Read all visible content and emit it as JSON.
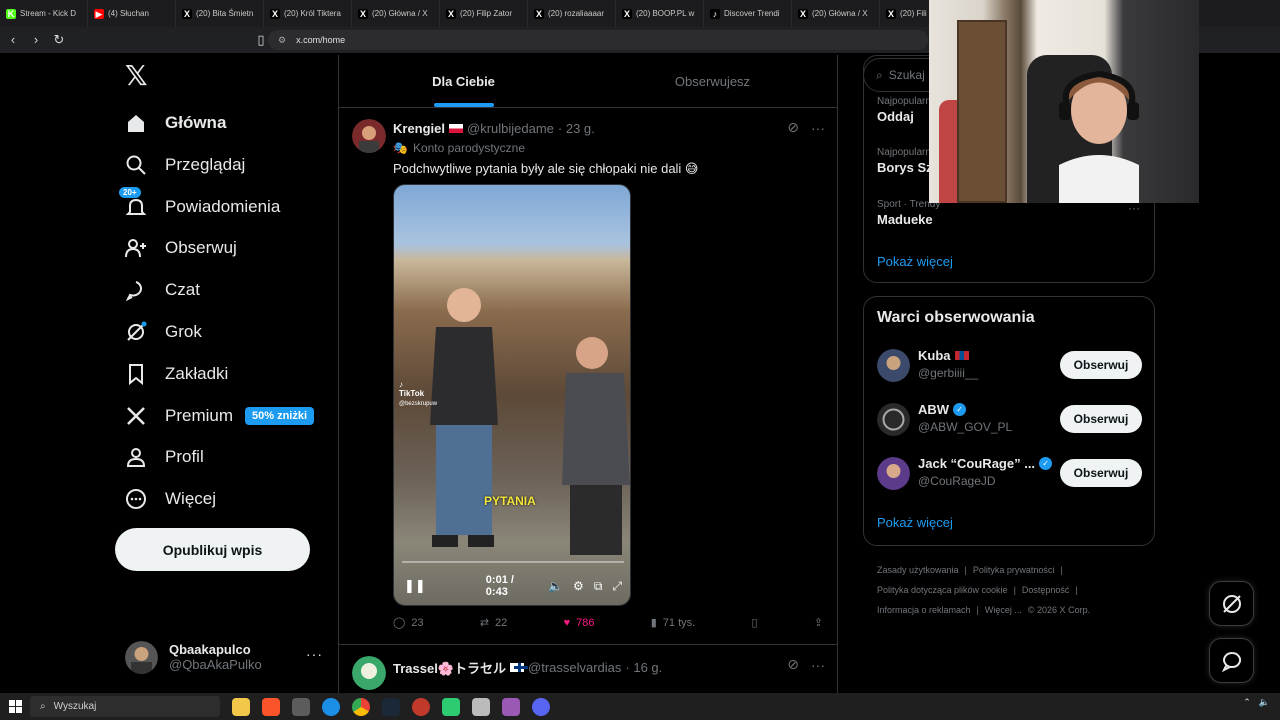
{
  "browser": {
    "tabs": [
      {
        "label": "Stream - Kick D",
        "icon": "kick-icon",
        "color": "#53fc18"
      },
      {
        "label": "(4) Słuchan",
        "icon": "youtube-icon",
        "color": "#ff0000"
      },
      {
        "label": "(20) Bita Śmietn",
        "icon": "x-icon",
        "color": "#000000"
      },
      {
        "label": "(20) Król Tiktera",
        "icon": "x-icon",
        "color": "#000000"
      },
      {
        "label": "(20) Główna / X",
        "icon": "x-icon",
        "color": "#000000"
      },
      {
        "label": "(20) Filip Zator",
        "icon": "x-icon",
        "color": "#000000"
      },
      {
        "label": "(20) rozaliaaaar",
        "icon": "x-icon",
        "color": "#000000"
      },
      {
        "label": "(20) BOOP.PL w",
        "icon": "x-icon",
        "color": "#000000"
      },
      {
        "label": "Discover Trendi",
        "icon": "tiktok-icon",
        "color": "#000000"
      },
      {
        "label": "(20) Główna / X",
        "icon": "x-icon",
        "color": "#000000"
      },
      {
        "label": "(20) Fili",
        "icon": "x-icon",
        "color": "#000000"
      }
    ],
    "url": "x.com/home"
  },
  "sidebar": {
    "items": [
      {
        "label": "Główna",
        "icon": "home-icon",
        "active": true
      },
      {
        "label": "Przeglądaj",
        "icon": "search-icon"
      },
      {
        "label": "Powiadomienia",
        "icon": "bell-icon",
        "badge": "20+"
      },
      {
        "label": "Obserwuj",
        "icon": "follow-icon"
      },
      {
        "label": "Czat",
        "icon": "chat-icon"
      },
      {
        "label": "Grok",
        "icon": "grok-icon"
      },
      {
        "label": "Zakładki",
        "icon": "bookmark-icon"
      },
      {
        "label": "Premium",
        "icon": "x-logo-icon",
        "pill": "50% zniżki"
      },
      {
        "label": "Profil",
        "icon": "profile-icon"
      },
      {
        "label": "Więcej",
        "icon": "more-circle-icon"
      }
    ],
    "post_button": "Opublikuj wpis",
    "account": {
      "name": "Qbaakapulco",
      "handle": "@QbaAkaPulko"
    }
  },
  "timeline": {
    "tabs": [
      "Dla Ciebie",
      "Obserwujesz"
    ],
    "tweet1": {
      "name": "Krengiel",
      "handle": "@krulbijedame",
      "time": "· 23 g.",
      "parody": "Konto parodystyczne",
      "text": "Podchwytliwe pytania były ale się chłopaki nie dali 😅",
      "video": {
        "caption": "PYTANIA",
        "watermark": "TikTok",
        "watermark_user": "@bezskrupuw",
        "time": "0:01 / 0:43"
      },
      "replies": "23",
      "reposts": "22",
      "likes": "786",
      "views": "71 tys."
    },
    "tweet2": {
      "name": "Trassel🌸トラセル",
      "handle": "@trasselvardias",
      "time": "· 16 g."
    }
  },
  "right": {
    "search_placeholder": "Szukaj",
    "trends": [
      {
        "category": "Najpopularniejsze",
        "name": "Oddaj"
      },
      {
        "category": "Najpopularniejsze",
        "name": "Borys Szyc"
      },
      {
        "category": "Sport · Trendy",
        "name": "Madueke"
      }
    ],
    "show_more": "Pokaż więcej",
    "who_to_follow": {
      "title": "Warci obserwowania",
      "users": [
        {
          "name": "Kuba",
          "handle": "@gerbiiii__",
          "verified": false
        },
        {
          "name": "ABW",
          "handle": "@ABW_GOV_PL",
          "verified": true
        },
        {
          "name": "Jack “CouRage” ...",
          "handle": "@CouRageJD",
          "verified": true
        }
      ],
      "follow_label": "Obserwuj",
      "show_more": "Pokaż więcej"
    },
    "footer": [
      "Zasady użytkowania",
      "|",
      "Polityka prywatności",
      "|",
      "Polityka dotycząca plików cookie",
      "|",
      "Dostępność",
      "|",
      "Informacja o reklamach",
      "|",
      "Więcej ...",
      "© 2026 X Corp."
    ]
  },
  "taskbar": {
    "search": "Wyszukaj"
  },
  "colors": {
    "accent": "#1d9bf0",
    "like": "#f91880",
    "bg": "#000000"
  }
}
